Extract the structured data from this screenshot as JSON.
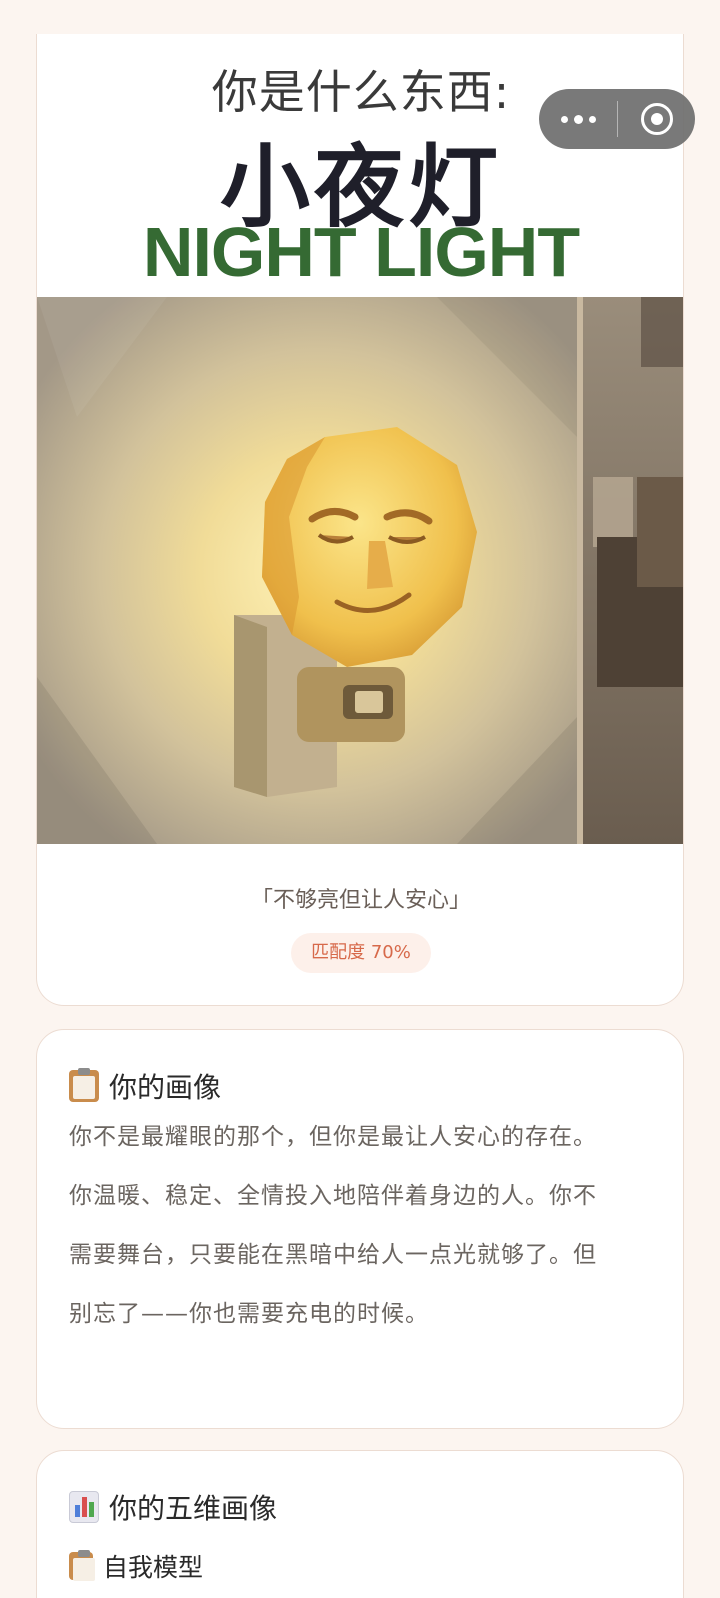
{
  "result": {
    "question": "你是什么东西:",
    "name_cn": "小夜灯",
    "name_en": "NIGHT LIGHT",
    "quote": "「不够亮但让人安心」",
    "match": "匹配度 70%"
  },
  "portrait": {
    "icon": "clipboard-icon",
    "title": "你的画像",
    "text": "你不是最耀眼的那个，但你是最让人安心的存在。你温暖、稳定、全情投入地陪伴着身边的人。你不需要舞台，只要能在黑暗中给人一点光就够了。但别忘了——你也需要充电的时候。"
  },
  "dimensions": {
    "icon": "bar-chart-icon",
    "title": "你的五维画像",
    "first_item_icon": "clipboard-icon",
    "first_item": "自我模型"
  },
  "colors": {
    "background": "#fcf5f0",
    "english_title": "#356a33",
    "badge_text": "#d7694a",
    "badge_bg": "#fdf0ea"
  }
}
